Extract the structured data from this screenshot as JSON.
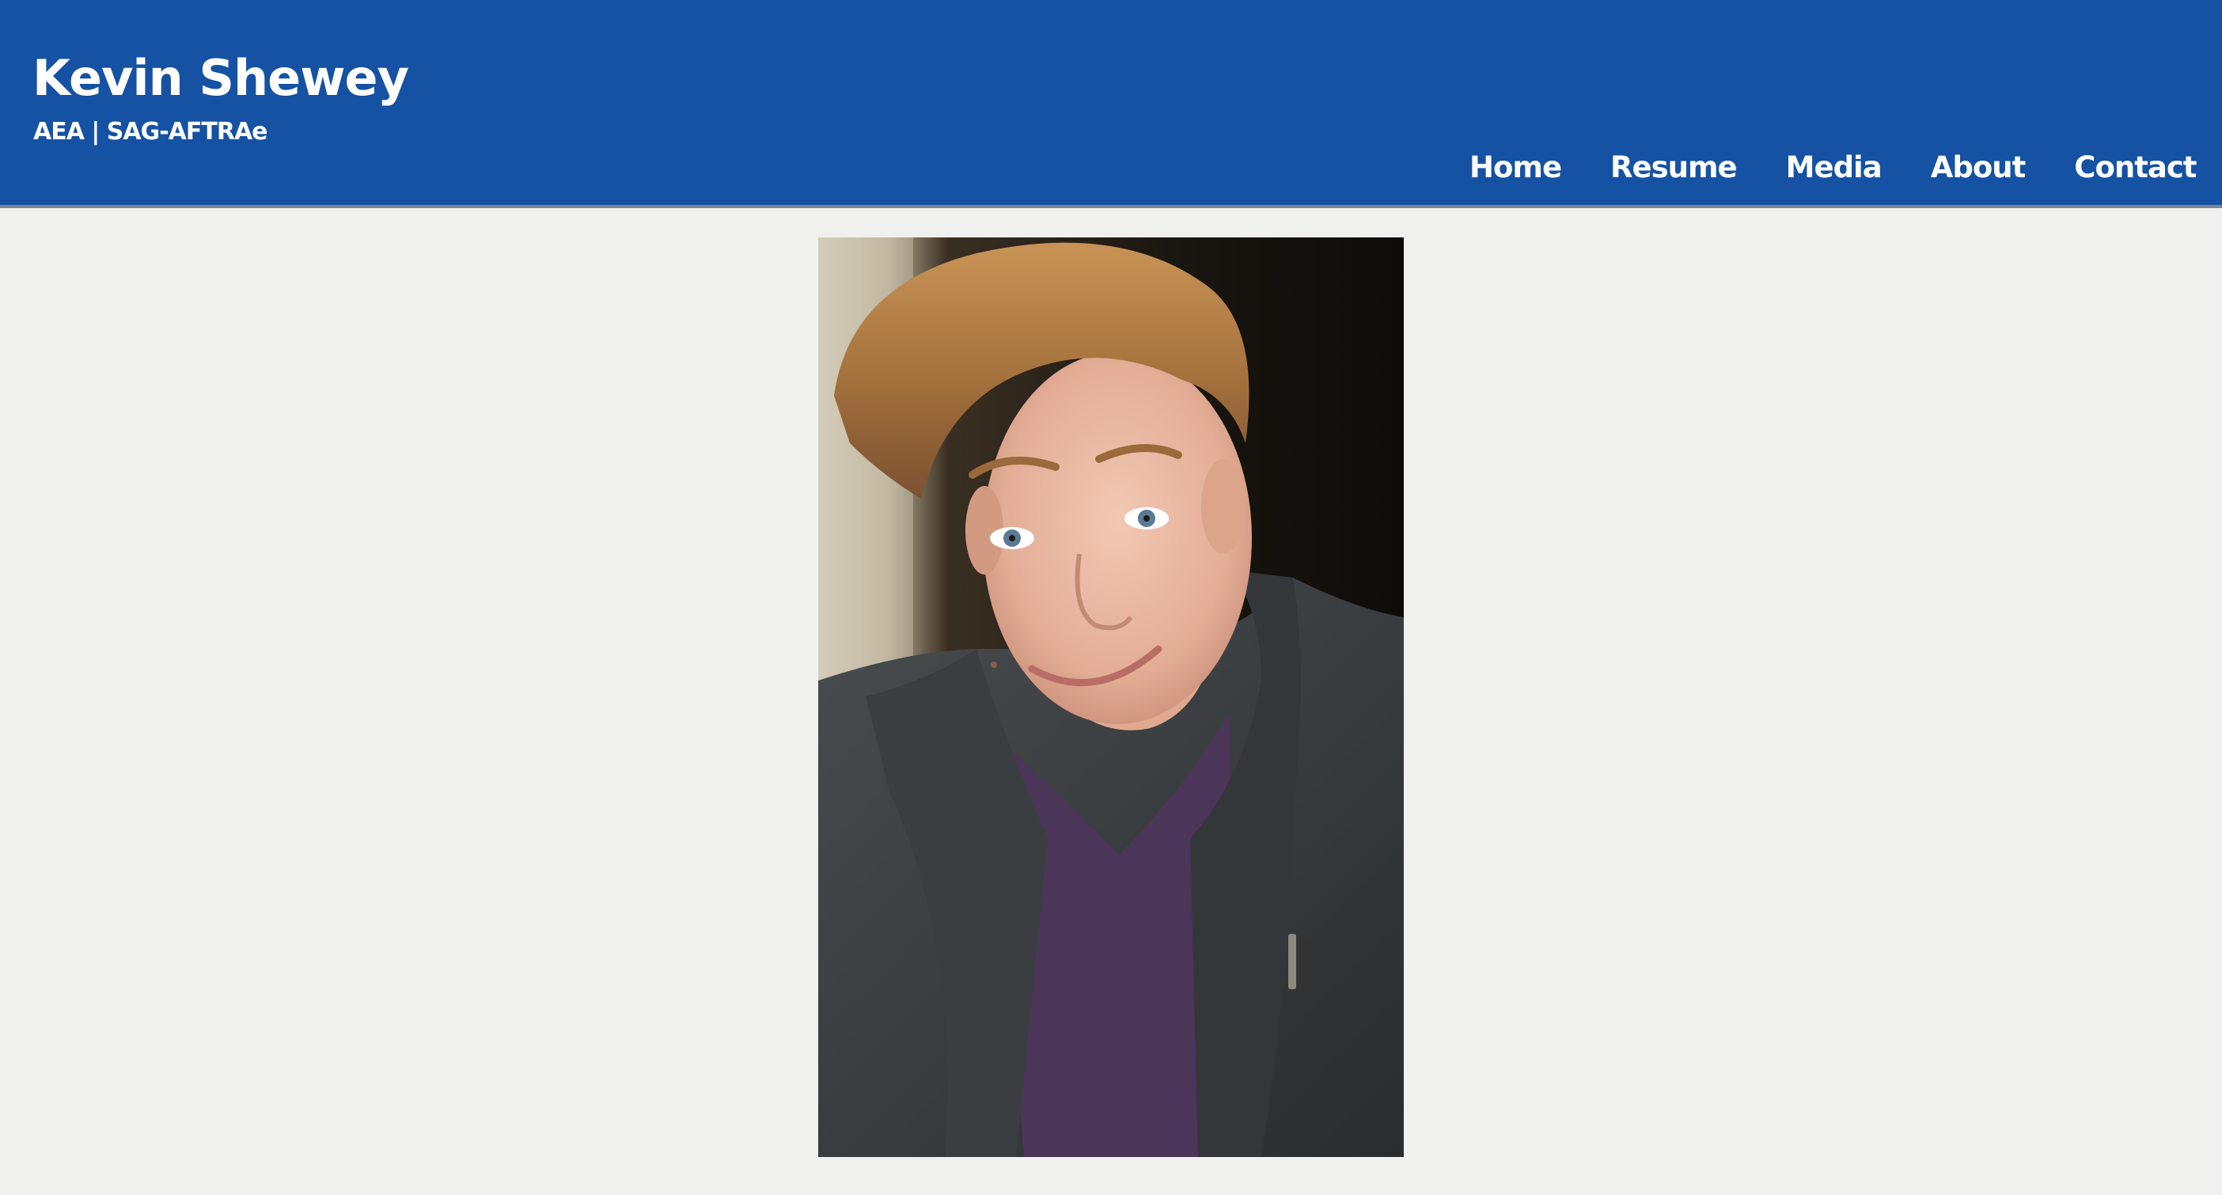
{
  "site": {
    "title": "Kevin Shewey",
    "subtitle": "AEA | SAG-AFTRAe"
  },
  "nav": {
    "items": [
      {
        "label": "Home"
      },
      {
        "label": "Resume"
      },
      {
        "label": "Media"
      },
      {
        "label": "About"
      },
      {
        "label": "Contact"
      }
    ]
  },
  "colors": {
    "header_bg": "#1552a3",
    "page_bg": "#f0f0ef",
    "nav_text": "#ffffff"
  }
}
